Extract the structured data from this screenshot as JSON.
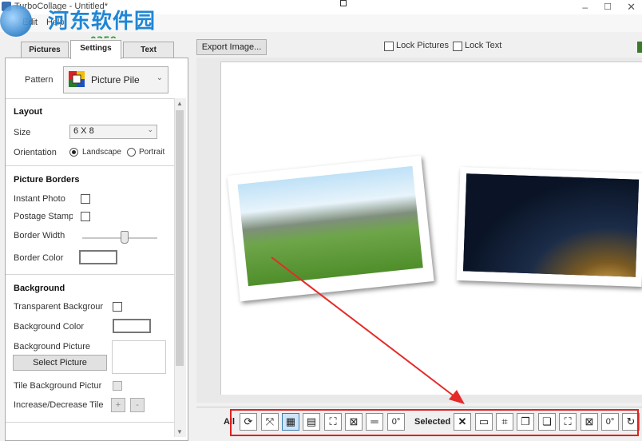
{
  "window": {
    "title": "TurboCollage - Untitled*"
  },
  "watermark": {
    "title": "河东软件园",
    "url": "www.pc0359.cn"
  },
  "menu": {
    "items": [
      "Edit",
      "Help"
    ]
  },
  "tabs": [
    {
      "label": "Pictures"
    },
    {
      "label": "Settings"
    },
    {
      "label": "Text"
    }
  ],
  "toolbar": {
    "export_label": "Export Image...",
    "lock_pictures": "Lock Pictures",
    "lock_text": "Lock Text"
  },
  "settings": {
    "pattern_label": "Pattern",
    "pattern_value": "Picture Pile",
    "layout": {
      "header": "Layout",
      "size_label": "Size",
      "size_value": "6 X 8",
      "orientation_label": "Orientation",
      "landscape": "Landscape",
      "portrait": "Portrait"
    },
    "borders": {
      "header": "Picture Borders",
      "instant_photo": "Instant Photo",
      "postage_stamp": "Postage Stamp",
      "border_width": "Border Width",
      "border_color": "Border Color",
      "border_width_level": 0.55
    },
    "background": {
      "header": "Background",
      "transparent": "Transparent Backgrour",
      "color": "Background Color",
      "picture": "Background Picture",
      "select_picture": "Select Picture",
      "tile": "Tile Background Pictur",
      "increase_decrease": "Increase/Decrease Tile",
      "plus": "+",
      "minus": "-"
    }
  },
  "bottombar": {
    "all_label": "All",
    "selected_label": "Selected",
    "zero_deg": "0°",
    "zero_deg2": "0°"
  },
  "colors": {
    "accent": "#3c7fb1",
    "highlight": "#e02020",
    "arrow": "#e52a2a"
  }
}
